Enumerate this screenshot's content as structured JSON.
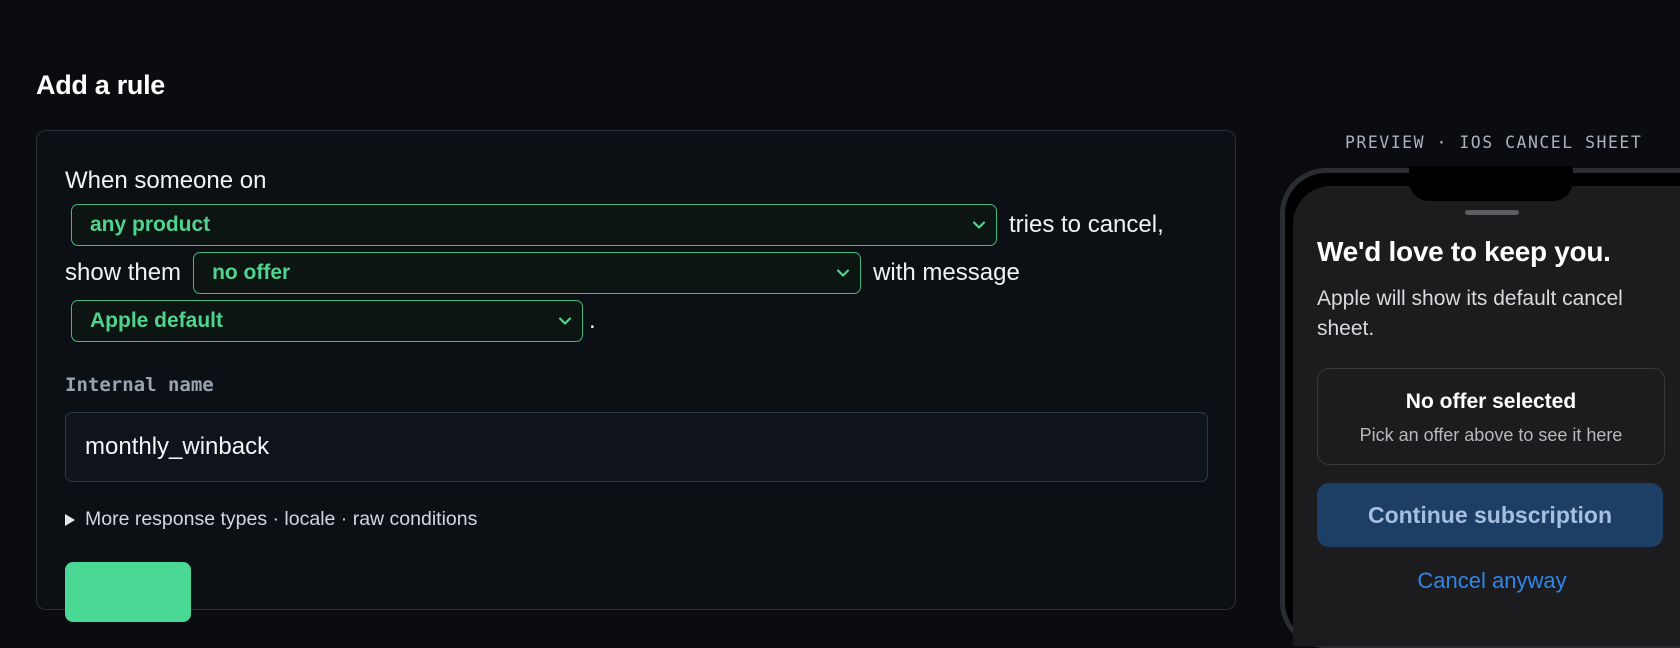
{
  "page": {
    "title": "Add a rule"
  },
  "rule": {
    "text_when": "When someone on",
    "product_select": {
      "value": "any product",
      "options": [
        "any product"
      ]
    },
    "text_tries": "tries to cancel,",
    "text_show": "show them",
    "offer_select": {
      "value": "no offer",
      "options": [
        "no offer"
      ]
    },
    "text_with": "with message",
    "message_select": {
      "value": "Apple default",
      "options": [
        "Apple default"
      ]
    },
    "text_period": ".",
    "internal_name_label": "Internal name",
    "internal_name_value": "monthly_winback",
    "more_options": "More response types · locale · raw conditions",
    "accent_color": "#4ad895"
  },
  "preview": {
    "label": "PREVIEW · IOS CANCEL SHEET",
    "sheet_title": "We'd love to keep you.",
    "sheet_message": "Apple will show its default cancel sheet.",
    "offer_title": "No offer selected",
    "offer_subtitle": "Pick an offer above to see it here",
    "continue_label": "Continue subscription",
    "cancel_label": "Cancel anyway"
  },
  "icons": [
    "chevron-down-icon",
    "disclosure-triangle-icon"
  ]
}
